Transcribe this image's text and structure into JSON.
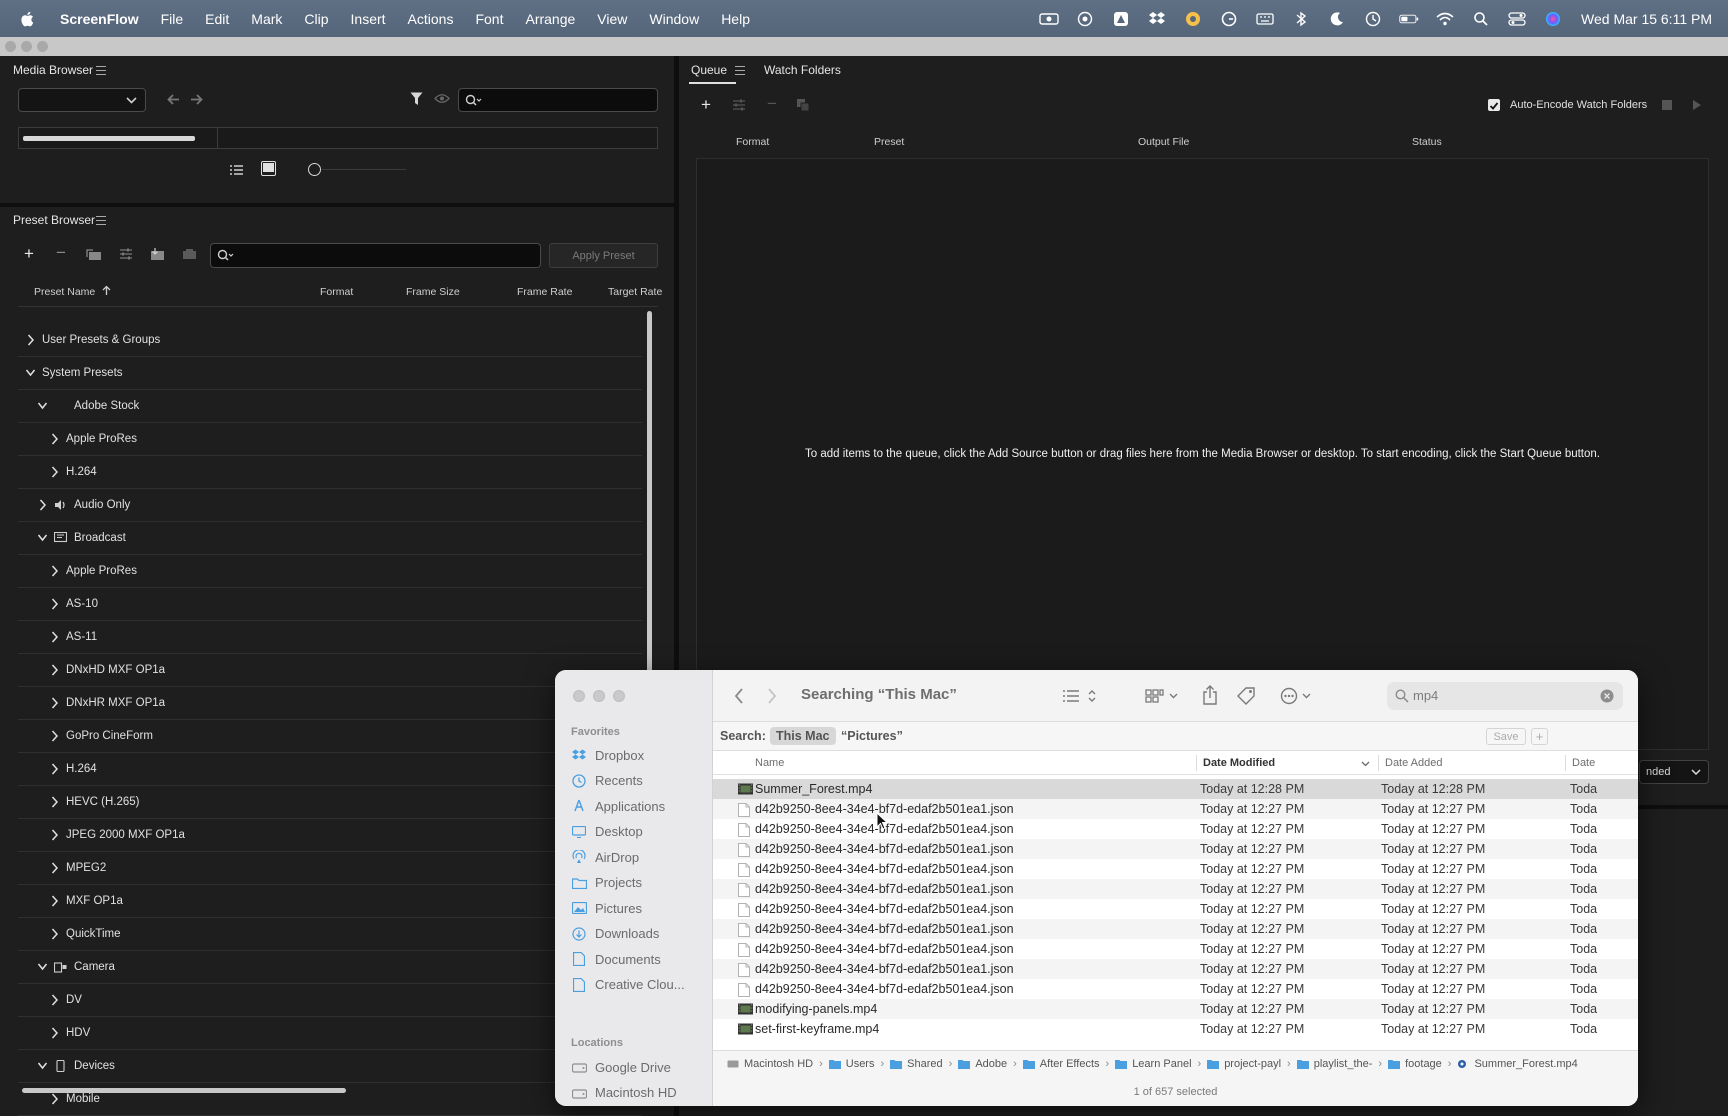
{
  "menubar": {
    "app_name": "ScreenFlow",
    "items": [
      "File",
      "Edit",
      "Mark",
      "Clip",
      "Insert",
      "Actions",
      "Font",
      "Arrange",
      "View",
      "Window",
      "Help"
    ],
    "clock": "Wed Mar 15  6:11 PM",
    "status_icons": [
      "screen-record-icon",
      "airplay-icon",
      "adobe-icon",
      "dropbox-icon",
      "adobe-cc-icon",
      "grammarly-icon",
      "keyboard-icon",
      "bluetooth-icon",
      "moon-icon",
      "time-machine-icon",
      "battery-icon",
      "wifi-icon",
      "spotlight-icon",
      "control-center-icon",
      "siri-icon"
    ]
  },
  "media_browser": {
    "title": "Media Browser",
    "dropdown_value": "",
    "search_value": ""
  },
  "preset_browser": {
    "title": "Preset Browser",
    "apply_button": "Apply Preset",
    "search_value": "",
    "columns": [
      "Preset Name",
      "Format",
      "Frame Size",
      "Frame Rate",
      "Target Rate"
    ],
    "rows": [
      {
        "label": "User Presets & Groups",
        "level": 0,
        "expanded": false,
        "icon": ""
      },
      {
        "label": "System Presets",
        "level": 0,
        "expanded": true,
        "icon": ""
      },
      {
        "label": "Adobe Stock",
        "level": 1,
        "expanded": true,
        "icon": ""
      },
      {
        "label": "Apple ProRes",
        "level": 2,
        "expanded": false,
        "icon": ""
      },
      {
        "label": "H.264",
        "level": 2,
        "expanded": false,
        "icon": ""
      },
      {
        "label": "Audio Only",
        "level": 1,
        "expanded": false,
        "icon": "speaker-icon"
      },
      {
        "label": "Broadcast",
        "level": 1,
        "expanded": true,
        "icon": "tv-icon"
      },
      {
        "label": "Apple ProRes",
        "level": 2,
        "expanded": false,
        "icon": ""
      },
      {
        "label": "AS-10",
        "level": 2,
        "expanded": false,
        "icon": ""
      },
      {
        "label": "AS-11",
        "level": 2,
        "expanded": false,
        "icon": ""
      },
      {
        "label": "DNxHD MXF OP1a",
        "level": 2,
        "expanded": false,
        "icon": ""
      },
      {
        "label": "DNxHR MXF OP1a",
        "level": 2,
        "expanded": false,
        "icon": ""
      },
      {
        "label": "GoPro CineForm",
        "level": 2,
        "expanded": false,
        "icon": ""
      },
      {
        "label": "H.264",
        "level": 2,
        "expanded": false,
        "icon": ""
      },
      {
        "label": "HEVC (H.265)",
        "level": 2,
        "expanded": false,
        "icon": ""
      },
      {
        "label": "JPEG 2000 MXF OP1a",
        "level": 2,
        "expanded": false,
        "icon": ""
      },
      {
        "label": "MPEG2",
        "level": 2,
        "expanded": false,
        "icon": ""
      },
      {
        "label": "MXF OP1a",
        "level": 2,
        "expanded": false,
        "icon": ""
      },
      {
        "label": "QuickTime",
        "level": 2,
        "expanded": false,
        "icon": ""
      },
      {
        "label": "Camera",
        "level": 1,
        "expanded": true,
        "icon": "camera-icon"
      },
      {
        "label": "DV",
        "level": 2,
        "expanded": false,
        "icon": ""
      },
      {
        "label": "HDV",
        "level": 2,
        "expanded": false,
        "icon": ""
      },
      {
        "label": "Devices",
        "level": 1,
        "expanded": true,
        "icon": "phone-icon"
      },
      {
        "label": "Mobile",
        "level": 2,
        "expanded": false,
        "icon": ""
      }
    ]
  },
  "queue": {
    "tab_queue": "Queue",
    "tab_watch": "Watch Folders",
    "auto_encode_label": "Auto-Encode Watch Folders",
    "auto_encode_checked": true,
    "columns": [
      "Format",
      "Preset",
      "Output File",
      "Status"
    ],
    "empty_message": "To add items to the queue, click the Add Source button or drag files here from the Media Browser or desktop.  To start encoding, click the Start Queue button.",
    "renderer_partial": "nded"
  },
  "finder": {
    "title": "Searching “This Mac”",
    "search_query": "mp4",
    "scope_label": "Search:",
    "scope_this_mac": "This Mac",
    "scope_pictures": "“Pictures”",
    "save_label": "Save",
    "sidebar": {
      "favorites_label": "Favorites",
      "favorites": [
        {
          "label": "Dropbox",
          "icon": "dropbox-icon"
        },
        {
          "label": "Recents",
          "icon": "clock-icon"
        },
        {
          "label": "Applications",
          "icon": "applications-icon"
        },
        {
          "label": "Desktop",
          "icon": "desktop-icon"
        },
        {
          "label": "AirDrop",
          "icon": "airdrop-icon"
        },
        {
          "label": "Projects",
          "icon": "folder-icon"
        },
        {
          "label": "Pictures",
          "icon": "pictures-icon"
        },
        {
          "label": "Downloads",
          "icon": "downloads-icon"
        },
        {
          "label": "Documents",
          "icon": "document-icon"
        },
        {
          "label": "Creative Clou...",
          "icon": "document-icon"
        }
      ],
      "locations_label": "Locations",
      "locations": [
        {
          "label": "Google Drive",
          "icon": "drive-icon"
        },
        {
          "label": "Macintosh HD",
          "icon": "disk-icon"
        }
      ]
    },
    "columns": {
      "name": "Name",
      "date_modified": "Date Modified",
      "date_added": "Date Added",
      "date_created": "Date"
    },
    "files": [
      {
        "name": "Summer_Forest.mp4",
        "modified": "Today at 12:28 PM",
        "added": "Today at 12:28 PM",
        "created": "Toda",
        "kind": "video",
        "selected": true
      },
      {
        "name": "d42b9250-8ee4-34e4-bf7d-edaf2b501ea1.json",
        "modified": "Today at 12:27 PM",
        "added": "Today at 12:27 PM",
        "created": "Toda",
        "kind": "doc",
        "selected": false
      },
      {
        "name": "d42b9250-8ee4-34e4-bf7d-edaf2b501ea4.json",
        "modified": "Today at 12:27 PM",
        "added": "Today at 12:27 PM",
        "created": "Toda",
        "kind": "doc",
        "selected": false
      },
      {
        "name": "d42b9250-8ee4-34e4-bf7d-edaf2b501ea1.json",
        "modified": "Today at 12:27 PM",
        "added": "Today at 12:27 PM",
        "created": "Toda",
        "kind": "doc",
        "selected": false
      },
      {
        "name": "d42b9250-8ee4-34e4-bf7d-edaf2b501ea4.json",
        "modified": "Today at 12:27 PM",
        "added": "Today at 12:27 PM",
        "created": "Toda",
        "kind": "doc",
        "selected": false
      },
      {
        "name": "d42b9250-8ee4-34e4-bf7d-edaf2b501ea1.json",
        "modified": "Today at 12:27 PM",
        "added": "Today at 12:27 PM",
        "created": "Toda",
        "kind": "doc",
        "selected": false
      },
      {
        "name": "d42b9250-8ee4-34e4-bf7d-edaf2b501ea4.json",
        "modified": "Today at 12:27 PM",
        "added": "Today at 12:27 PM",
        "created": "Toda",
        "kind": "doc",
        "selected": false
      },
      {
        "name": "d42b9250-8ee4-34e4-bf7d-edaf2b501ea1.json",
        "modified": "Today at 12:27 PM",
        "added": "Today at 12:27 PM",
        "created": "Toda",
        "kind": "doc",
        "selected": false
      },
      {
        "name": "d42b9250-8ee4-34e4-bf7d-edaf2b501ea4.json",
        "modified": "Today at 12:27 PM",
        "added": "Today at 12:27 PM",
        "created": "Toda",
        "kind": "doc",
        "selected": false
      },
      {
        "name": "d42b9250-8ee4-34e4-bf7d-edaf2b501ea1.json",
        "modified": "Today at 12:27 PM",
        "added": "Today at 12:27 PM",
        "created": "Toda",
        "kind": "doc",
        "selected": false
      },
      {
        "name": "d42b9250-8ee4-34e4-bf7d-edaf2b501ea4.json",
        "modified": "Today at 12:27 PM",
        "added": "Today at 12:27 PM",
        "created": "Toda",
        "kind": "doc",
        "selected": false
      },
      {
        "name": "modifying-panels.mp4",
        "modified": "Today at 12:27 PM",
        "added": "Today at 12:27 PM",
        "created": "Toda",
        "kind": "video",
        "selected": false
      },
      {
        "name": "set-first-keyframe.mp4",
        "modified": "Today at 12:27 PM",
        "added": "Today at 12:27 PM",
        "created": "Toda",
        "kind": "video",
        "selected": false
      }
    ],
    "path": [
      {
        "label": "Macintosh HD",
        "icon": "disk-icon"
      },
      {
        "label": "Users",
        "icon": "folder-icon"
      },
      {
        "label": "Shared",
        "icon": "folder-icon"
      },
      {
        "label": "Adobe",
        "icon": "folder-icon"
      },
      {
        "label": "After Effects",
        "icon": "folder-icon"
      },
      {
        "label": "Learn Panel",
        "icon": "folder-icon"
      },
      {
        "label": "project-payl",
        "icon": "folder-icon"
      },
      {
        "label": "playlist_the-",
        "icon": "folder-icon"
      },
      {
        "label": "footage",
        "icon": "folder-icon"
      },
      {
        "label": "Summer_Forest.mp4",
        "icon": "video-file-icon"
      }
    ],
    "status": "1 of 657 selected"
  },
  "colors": {
    "menubar": "#5b6b80",
    "panel_bg": "#1e1e1e",
    "folder_blue": "#4a9fe0"
  }
}
